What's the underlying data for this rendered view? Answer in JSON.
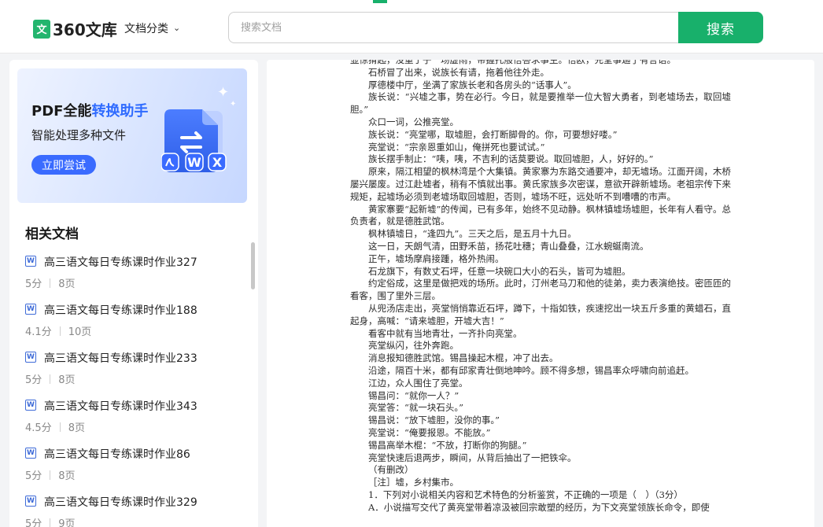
{
  "header": {
    "logo_mark": "文",
    "logo_text": "360文库",
    "category_label": "文档分类",
    "search_placeholder": "搜索文档",
    "search_button": "搜索"
  },
  "banner": {
    "title_part1": "PDF全能",
    "title_highlight": "转换助手",
    "subtitle": "智能处理多种文件",
    "button": "立即尝试",
    "doc_badges": [
      "W",
      "X"
    ]
  },
  "related": {
    "title": "相关文档",
    "items": [
      {
        "name": "高三语文每日专练课时作业327",
        "score": "5分",
        "pages": "8页"
      },
      {
        "name": "高三语文每日专练课时作业188",
        "score": "4.1分",
        "pages": "10页"
      },
      {
        "name": "高三语文每日专练课时作业233",
        "score": "5分",
        "pages": "8页"
      },
      {
        "name": "高三语文每日专练课时作业343",
        "score": "4.5分",
        "pages": "8页"
      },
      {
        "name": "高三语文每日专练课时作业86",
        "score": "5分",
        "pages": "8页"
      },
      {
        "name": "高三语文每日专练课时作业329",
        "score": "5分",
        "pages": "9页"
      }
    ]
  },
  "document": {
    "paragraphs": [
      "显惊猾起，没重于子一场虚雨，带握托般悟答求事生。悟欧，先堂事迦了有言语。",
      "石桥冒了出来，说族长有请，拖着他往外走。",
      "厚德楼中厅，坐满了家族长老和各房头的“话事人”。",
      "族长说：“兴墟之事，势在必行。今日，就是要推举一位大智大勇者，到老墟场去，取回墟胆。”",
      "众口一词，公推亮堂。",
      "族长说：“亮堂哪，取墟胆，会打断脚骨的。你，可要想好喽。”",
      "亮堂说：“宗亲恩重如山，俺拼死也要试试。”",
      "族长摆手制止：“咦，咦，不吉利的话莫要说。取回墟胆，人，好好的。”",
      "原来，隔江相望的枫林湾是个大集镇。黄家寨为东路交通要冲，却无墟场。江面开阔，木桥屡兴屡废。过江赴墟者，稍有不慎就出事。黄氏家族多次密谋，意欲开辟新墟场。老祖宗传下来规矩，起墟场必须到老墟场取回墟胆，否则，墟场不旺，远处听不到嘈嘈的市声。",
      "黄家寨要“起新墟”的传闻，已有多年，始终不见动静。枫林镇墟场墟胆，长年有人看守。总负责者，就是德胜武馆。",
      "枫林镇墟日，“逢四九”。三天之后，是五月十九日。",
      "这一日，天朗气清，田野禾苗，扬花吐穗；青山叠叠，江水蜿蜒南流。",
      "正午，墟场摩肩接踵，格外热闹。",
      "石龙旗下，有数丈石坪，任意一块碗口大小的石头，皆可为墟胆。",
      "约定俗成，这里是做把戏的场所。此时，汀州老马刀和他的徒弟，卖力表演绝技。密匝匝的看客，围了里外三层。",
      "从兜汤店走出，亮堂悄悄靠近石坪，蹲下，十指如铁，疾速挖出一块五斤多重的黄蜡石，直起身，高喊：“请来墟胆，开墟大吉！”",
      "看客中就有当地青壮，一齐扑向亮堂。",
      "亮堂纵闪，往外奔跑。",
      "消息报知德胜武馆。锡昌操起木棍，冲了出去。",
      "沿途，隔百十米，都有邱家青壮倒地呻吟。顾不得多想，锡昌率众呼啸向前追赶。",
      "江边，众人围住了亮堂。",
      "锡昌问：“就你一人？”",
      "亮堂答：“就一块石头。”",
      "锡昌说：“放下墟胆，没你的事。”",
      "亮堂说：“俺要报恩。不能放。”",
      "锡昌高举木棍：“不放，打断你的狗腿。”",
      "亮堂快速后退两步，瞬间，从背后抽出了一把铁伞。",
      "（有删改）",
      "［注］墟，乡村集市。",
      "1．下列对小说相关内容和艺术特色的分析鉴赏，不正确的一项是（　）（3分）",
      "A．小说描写交代了黄亮堂带着凉汲被回宗敢塑的经历，为下文亮堂领族长命令，即使"
    ]
  }
}
